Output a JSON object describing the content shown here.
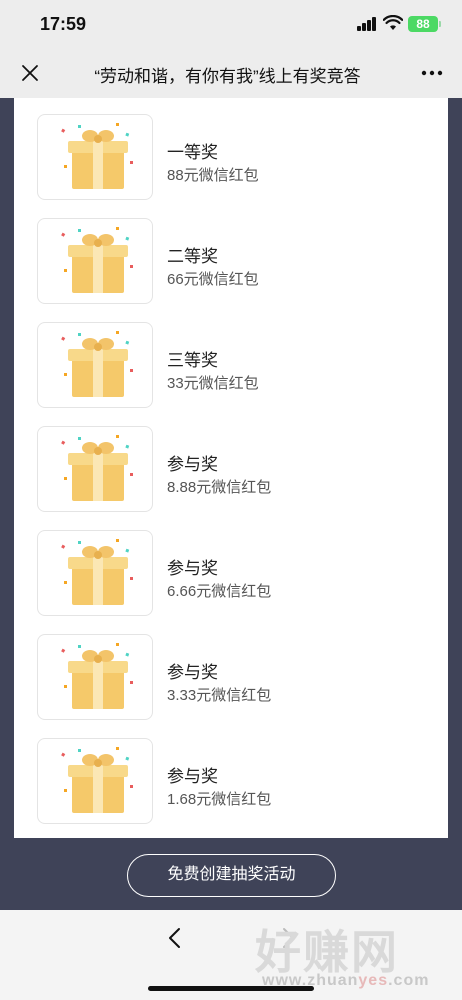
{
  "status_bar": {
    "time": "17:59",
    "battery": "88"
  },
  "nav": {
    "title": "“劳动和谐，有你有我”线上有奖竞答"
  },
  "prizes": [
    {
      "name": "一等奖",
      "desc": "88元微信红包",
      "icon": "gift-box-icon"
    },
    {
      "name": "二等奖",
      "desc": "66元微信红包",
      "icon": "gift-box-icon"
    },
    {
      "name": "三等奖",
      "desc": "33元微信红包",
      "icon": "gift-box-icon"
    },
    {
      "name": "参与奖",
      "desc": "8.88元微信红包",
      "icon": "gift-box-icon"
    },
    {
      "name": "参与奖",
      "desc": "6.66元微信红包",
      "icon": "gift-box-icon"
    },
    {
      "name": "参与奖",
      "desc": "3.33元微信红包",
      "icon": "gift-box-icon"
    },
    {
      "name": "参与奖",
      "desc": "1.68元微信红包",
      "icon": "gift-box-icon"
    }
  ],
  "create_button": {
    "label": "免费创建抽奖活动"
  },
  "watermark": {
    "text": "好赚网",
    "url_prefix": "www.zhuan",
    "url_highlight": "yes",
    "url_suffix": ".com"
  },
  "colors": {
    "background": "#3f4358",
    "gift": "#f5c96a",
    "battery": "#4cd964"
  }
}
